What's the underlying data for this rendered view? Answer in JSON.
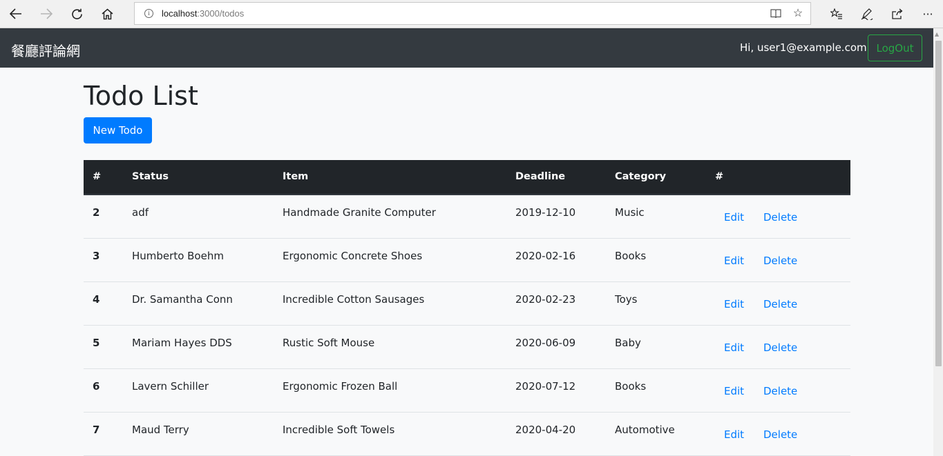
{
  "browser": {
    "url_host": "localhost",
    "url_path": ":3000/todos",
    "icons": [
      "back-icon",
      "forward-icon",
      "refresh-icon",
      "home-icon",
      "info-icon",
      "reading-view-icon",
      "favorite-star-icon",
      "favorites-list-icon",
      "pen-icon",
      "share-icon",
      "more-icon"
    ]
  },
  "navbar": {
    "brand": "餐廳評論網",
    "greeting": "Hi, user1@example.com",
    "logout_label": "LogOut"
  },
  "colors": {
    "navbar_bg": "#343a40",
    "primary": "#007bff",
    "success": "#28a745",
    "table_head_bg": "#212529"
  },
  "main": {
    "title": "Todo List",
    "new_button": "New Todo"
  },
  "table": {
    "headers": [
      "#",
      "Status",
      "Item",
      "Deadline",
      "Category",
      "#"
    ],
    "rows": [
      {
        "id": "2",
        "status": "adf",
        "item": "Handmade Granite Computer",
        "deadline": "2019-12-10",
        "category": "Music",
        "edit": "Edit",
        "delete": "Delete"
      },
      {
        "id": "3",
        "status": "Humberto Boehm",
        "item": "Ergonomic Concrete Shoes",
        "deadline": "2020-02-16",
        "category": "Books",
        "edit": "Edit",
        "delete": "Delete"
      },
      {
        "id": "4",
        "status": "Dr. Samantha Conn",
        "item": "Incredible Cotton Sausages",
        "deadline": "2020-02-23",
        "category": "Toys",
        "edit": "Edit",
        "delete": "Delete"
      },
      {
        "id": "5",
        "status": "Mariam Hayes DDS",
        "item": "Rustic Soft Mouse",
        "deadline": "2020-06-09",
        "category": "Baby",
        "edit": "Edit",
        "delete": "Delete"
      },
      {
        "id": "6",
        "status": "Lavern Schiller",
        "item": "Ergonomic Frozen Ball",
        "deadline": "2020-07-12",
        "category": "Books",
        "edit": "Edit",
        "delete": "Delete"
      },
      {
        "id": "7",
        "status": "Maud Terry",
        "item": "Incredible Soft Towels",
        "deadline": "2020-04-20",
        "category": "Automotive",
        "edit": "Edit",
        "delete": "Delete"
      }
    ]
  }
}
